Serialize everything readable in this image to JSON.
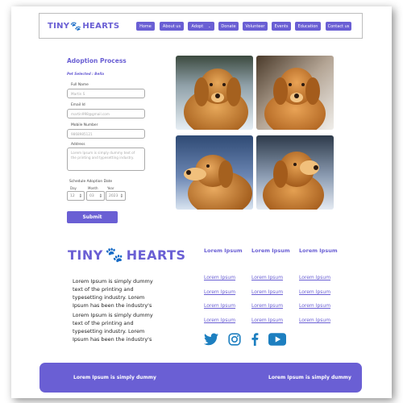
{
  "brand": {
    "name_left": "TINY",
    "name_right": "HEARTS",
    "paw_glyph": "🐾",
    "accent_color": "#6a5fd4",
    "paw_color": "#c44fc7"
  },
  "nav": {
    "items": [
      {
        "label": "Home"
      },
      {
        "label": "About us"
      },
      {
        "label": "Adopt",
        "caret": "⌄"
      },
      {
        "label": "Donate"
      },
      {
        "label": "Volunteer"
      },
      {
        "label": "Events"
      },
      {
        "label": "Education"
      },
      {
        "label": "Contact us"
      }
    ]
  },
  "form": {
    "title": "Adoption Process",
    "pet_selected": "Pet Selected : Bella",
    "full_name": {
      "label": "Full Name",
      "value": "Martin S"
    },
    "email": {
      "label": "Email Id",
      "value": "martin998@gmail.com"
    },
    "mobile": {
      "label": "Mobile Number",
      "value": "9868985121"
    },
    "address": {
      "label": "Address",
      "value": "Lorem Ipsum is simply dummy text of the printing and typesetting industry."
    },
    "schedule": {
      "label": "Schedule Adoption Date",
      "day_label": "Day",
      "day": "12",
      "month_label": "Month",
      "month": "03",
      "year_label": "Year",
      "year": "2023"
    },
    "submit_label": "Submit"
  },
  "photos": [
    {
      "icon": "golden-retriever-photo"
    },
    {
      "icon": "golden-retriever-photo"
    },
    {
      "icon": "golden-retriever-photo"
    },
    {
      "icon": "golden-retriever-photo"
    }
  ],
  "footer": {
    "paragraph_1": "Lorem Ipsum is simply dummy text of the printing and typesetting industry. Lorem Ipsum has been the industry's",
    "paragraph_2": "Lorem Ipsum is simply dummy text of the printing and typesetting industry. Lorem Ipsum has been the industry's",
    "columns": [
      {
        "heading": "Lorem Ipsum",
        "links": [
          "Lorem Ipsum",
          "Lorem Ipsum",
          "Lorem Ipsum",
          "Lorem Ipsum"
        ]
      },
      {
        "heading": "Lorem Ipsum",
        "links": [
          "Lorem Ipsum",
          "Lorem Ipsum",
          "Lorem Ipsum",
          "Lorem Ipsum"
        ]
      },
      {
        "heading": "Lorem Ipsum",
        "links": [
          "Lorem Ipsum",
          "Lorem Ipsum",
          "Lorem Ipsum",
          "Lorem Ipsum"
        ]
      }
    ],
    "social": [
      "twitter-icon",
      "instagram-icon",
      "facebook-icon",
      "youtube-icon"
    ],
    "banner_left": "Lorem Ipsum is simply dummy",
    "banner_right": "Lorem Ipsum is simply dummy"
  }
}
